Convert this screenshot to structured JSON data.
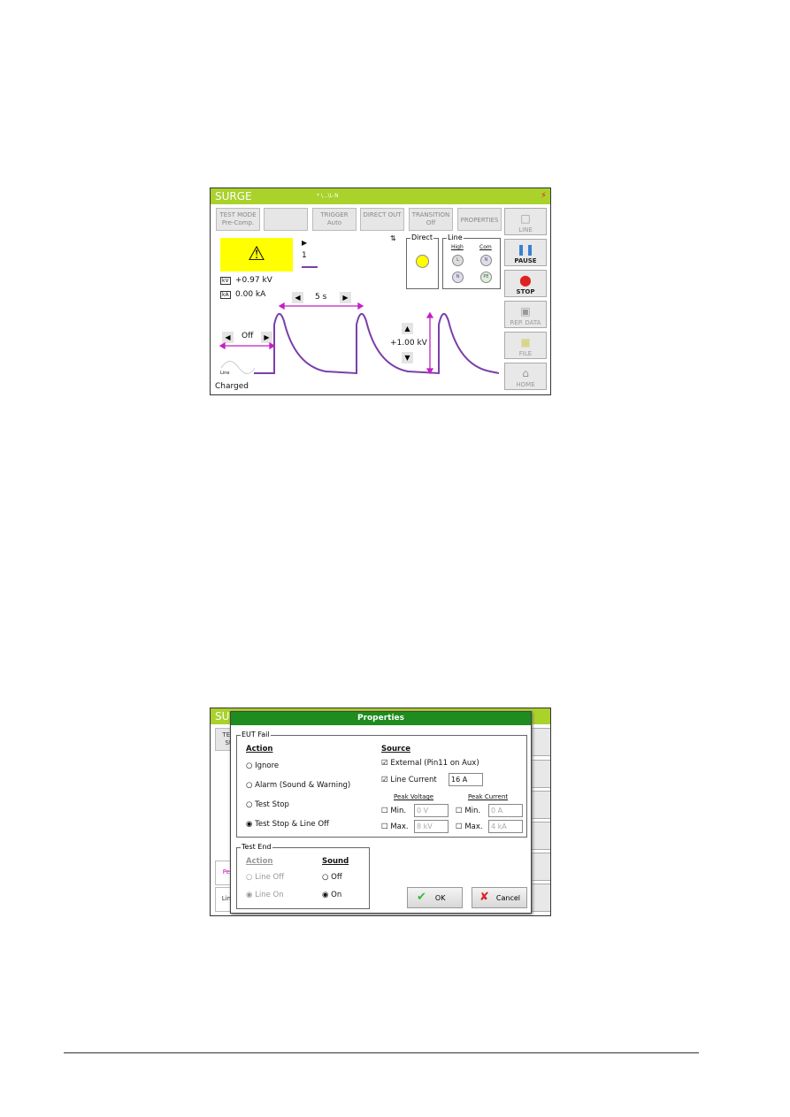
{
  "screen1": {
    "title": "SURGE",
    "status": "* \\...\\L-N",
    "buttons": [
      {
        "l1": "TEST MODE",
        "l2": "Pre-Comp."
      },
      {
        "l1": "",
        "l2": ""
      },
      {
        "l1": "TRIGGER",
        "l2": "Auto"
      },
      {
        "l1": "DIRECT OUT",
        "l2": ""
      },
      {
        "l1": "TRANSITION",
        "l2": "Off"
      },
      {
        "l1": "PROPERTIES",
        "l2": ""
      }
    ],
    "side": [
      {
        "label": "LINE",
        "icon": "line-icon"
      },
      {
        "label": "PAUSE",
        "icon": "pause-icon"
      },
      {
        "label": "STOP",
        "icon": "stop-icon"
      },
      {
        "label": "REP. DATA",
        "icon": "save-icon"
      },
      {
        "label": "FILE",
        "icon": "folder-icon"
      },
      {
        "label": "HOME",
        "icon": "home-icon"
      }
    ],
    "counter": "1",
    "voltage": "+0.97 kV",
    "current": "0.00 kA",
    "period": "5 s",
    "delay": "Off",
    "amplitude": "+1.00 kV",
    "line_label": "Line",
    "state": "Charged",
    "direct_label": "Direct",
    "line_group": "Line",
    "high": "High",
    "com": "Com",
    "couplings": [
      "L",
      "N",
      "N",
      "PE"
    ],
    "colors": {
      "title": "#a9d22b",
      "wave": "#7b3fa8",
      "arrow": "#c41fc4",
      "warning": "#ffff00"
    }
  },
  "screen2": {
    "bg_title": "SU",
    "bg_test": "TES",
    "bg_st": "St",
    "bg_peak": "Pea",
    "bg_line": "Line",
    "dialog_title": "Properties",
    "eut_fail": "EUT Fail",
    "action": "Action",
    "source": "Source",
    "actions": [
      {
        "label": "Ignore",
        "checked": false
      },
      {
        "label": "Alarm (Sound & Warning)",
        "checked": false
      },
      {
        "label": "Test Stop",
        "checked": false
      },
      {
        "label": "Test Stop & Line Off",
        "checked": true
      }
    ],
    "external": "External (Pin11 on Aux)",
    "line_current": "Line Current",
    "line_current_value": "16 A",
    "peak_voltage": "Peak Voltage",
    "peak_current": "Peak Current",
    "min": "Min.",
    "max": "Max.",
    "pv_min": "0 V",
    "pv_max": "8 kV",
    "pc_min": "0 A",
    "pc_max": "4 kA",
    "test_end": "Test End",
    "end_action": "Action",
    "sound": "Sound",
    "line_off": "Line Off",
    "line_on": "Line On",
    "sound_off": "Off",
    "sound_on": "On",
    "ok": "OK",
    "cancel": "Cancel",
    "colors": {
      "dialog_title": "#1e8c1e"
    }
  }
}
